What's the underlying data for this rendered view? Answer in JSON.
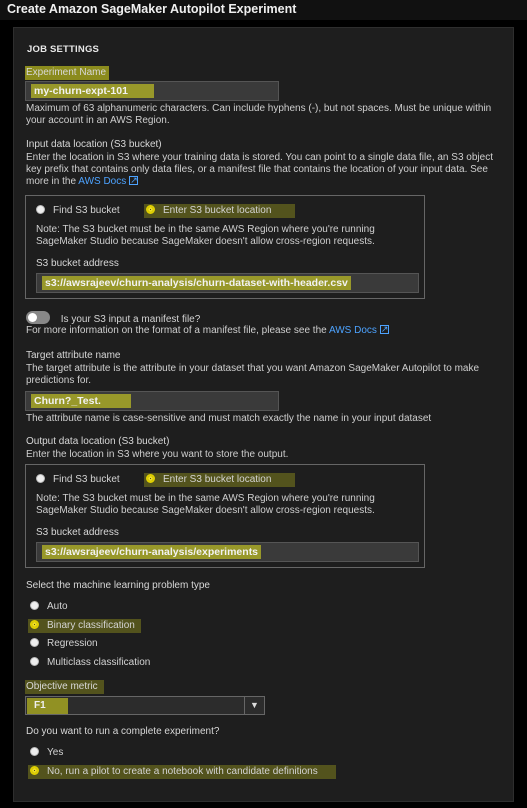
{
  "window": {
    "title": "Create Amazon SageMaker Autopilot Experiment"
  },
  "job_settings": {
    "heading": "JOB SETTINGS",
    "experiment_name": {
      "label": "Experiment Name",
      "value": "my-churn-expt-101",
      "help": "Maximum of 63 alphanumeric characters. Can include hyphens (-), but not spaces. Must be unique within your account in an AWS Region."
    },
    "input_location": {
      "label": "Input data location (S3 bucket)",
      "help": "Enter the location in S3 where your training data is stored. You can point to a single data file, an S3 object key prefix that contains only data files, or a manifest file that contains the location of your input data. See more in the",
      "docs_link": "AWS Docs",
      "options": [
        "Find S3 bucket",
        "Enter S3 bucket location"
      ],
      "selected": 1,
      "note": "Note: The S3 bucket must be in the same AWS Region where you're running SageMaker Studio because SageMaker doesn't allow cross-region requests.",
      "address_label": "S3 bucket address",
      "address_value": "s3://awsrajeev/churn-analysis/churn-dataset-with-header.csv"
    },
    "manifest": {
      "label": "Is your S3 input a manifest file?",
      "enabled": false,
      "help": "For more information on the format of a manifest file, please see the",
      "docs_link": "AWS Docs"
    },
    "target": {
      "label": "Target attribute name",
      "help": "The target attribute is the attribute in your dataset that you want Amazon SageMaker Autopilot to make predictions for.",
      "value": "Churn?_Test.",
      "note": "The attribute name is case-sensitive and must match exactly the name in your input dataset"
    },
    "output_location": {
      "label": "Output data location (S3 bucket)",
      "help": "Enter the location in S3 where you want to store the output.",
      "options": [
        "Find S3 bucket",
        "Enter S3 bucket location"
      ],
      "selected": 1,
      "note": "Note: The S3 bucket must be in the same AWS Region where you're running SageMaker Studio because SageMaker doesn't allow cross-region requests.",
      "address_label": "S3 bucket address",
      "address_value": "s3://awsrajeev/churn-analysis/experiments"
    },
    "problem_type": {
      "label": "Select the machine learning problem type",
      "options": [
        "Auto",
        "Binary classification",
        "Regression",
        "Multiclass classification"
      ],
      "selected": 1
    },
    "objective": {
      "label": "Objective metric",
      "value": "F1"
    },
    "complete_experiment": {
      "label": "Do you want to run a complete experiment?",
      "options": [
        "Yes",
        "No, run a pilot to create a notebook with candidate definitions"
      ],
      "selected": 1
    }
  }
}
